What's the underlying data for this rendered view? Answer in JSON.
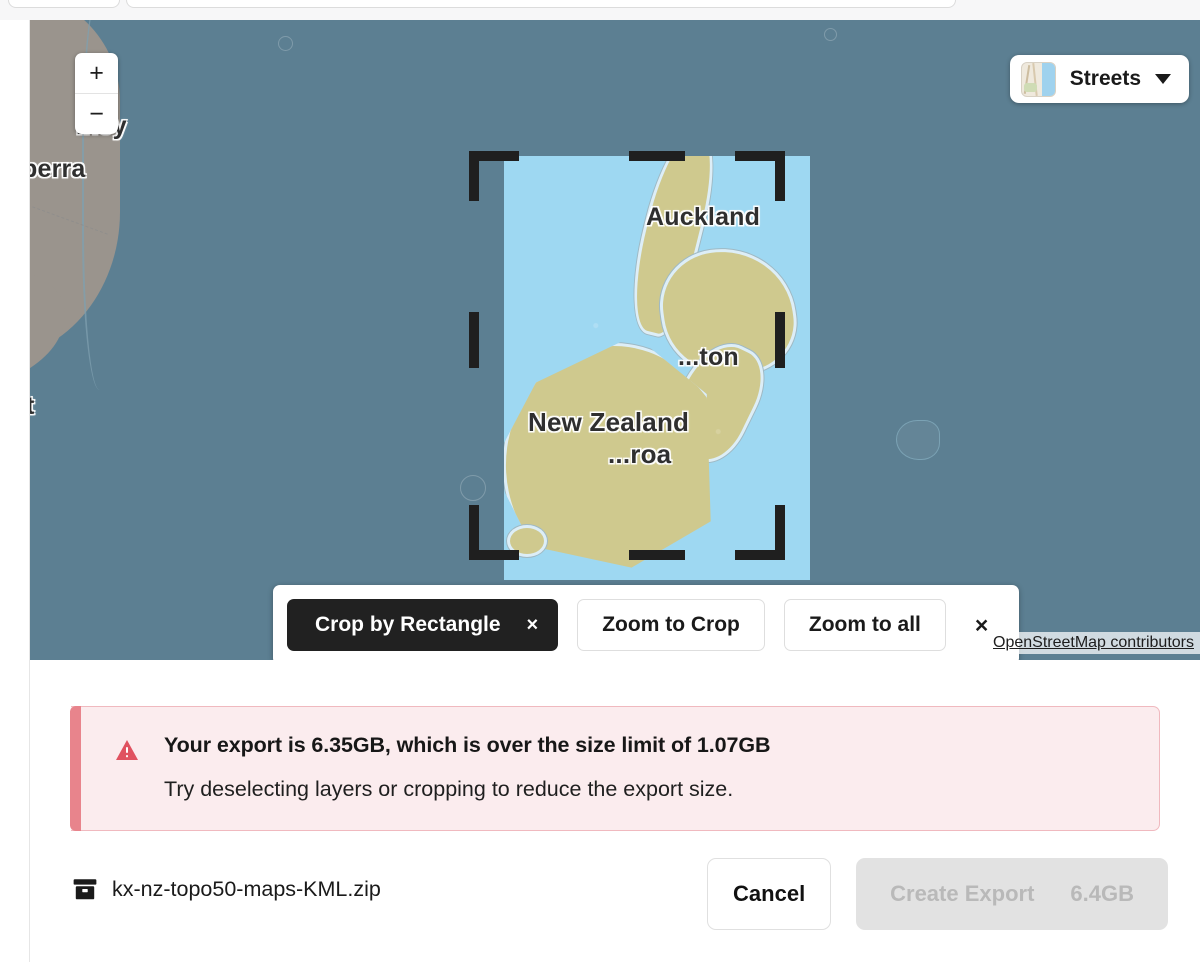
{
  "map": {
    "zoom_in_label": "+",
    "zoom_out_label": "−",
    "basemap_label": "Streets",
    "attribution": "OpenStreetMap contributors",
    "labels": {
      "sydney": "lney",
      "canberra": "berra",
      "hobart": "t",
      "auckland": "Auckland",
      "wellington": "...ton",
      "new_zealand": "New Zealand",
      "aotearoa": "...roa"
    }
  },
  "crop_toolbar": {
    "mode_label": "Crop by Rectangle",
    "mode_clear": "×",
    "zoom_to_crop": "Zoom to Crop",
    "zoom_to_all": "Zoom to all",
    "close": "×"
  },
  "alert": {
    "icon": "warning-triangle-icon",
    "title": "Your export is 6.35GB, which is over the size limit of 1.07GB",
    "subtitle": "Try deselecting layers or cropping to reduce the export size.",
    "accent_color": "#e8848c",
    "background_color": "#fbecee",
    "icon_color": "#e05260"
  },
  "footer": {
    "file_icon": "archive-box-icon",
    "file_name": "kx-nz-topo50-maps-KML.zip",
    "cancel_label": "Cancel",
    "create_export_label": "Create Export",
    "create_export_size": "6.4GB"
  },
  "colors": {
    "ocean": "#5c7f92",
    "crop_fill": "#9ed8f2",
    "land": "#cfc98e",
    "australia": "#9a948d"
  }
}
